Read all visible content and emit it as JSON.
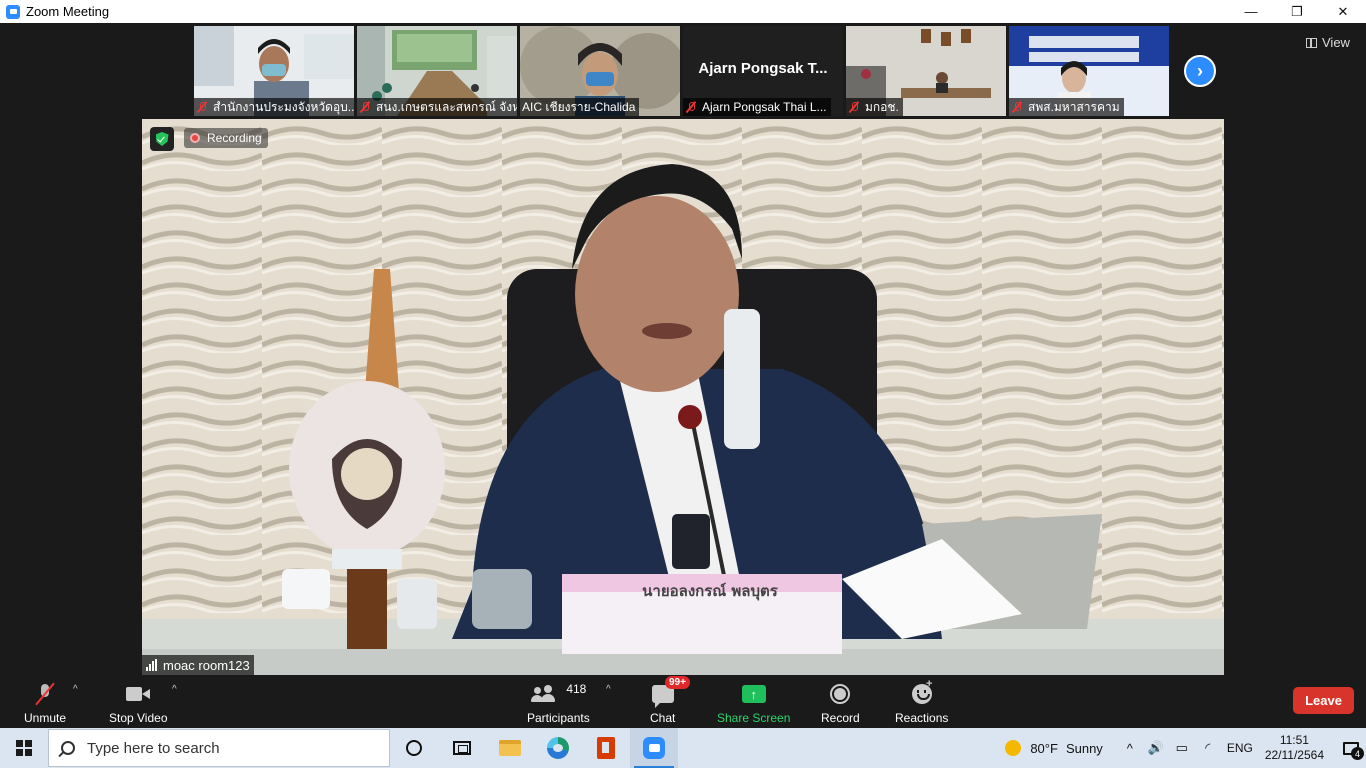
{
  "window": {
    "title": "Zoom Meeting",
    "minimize": "—",
    "restore": "❐",
    "close": "✕"
  },
  "gallery": {
    "participants": [
      {
        "name": "สำนักงานประมงจังหวัดอุบ...",
        "muted": true,
        "type": "video"
      },
      {
        "name": "สนง.เกษตรและสหกรณ์ จังหวั...",
        "muted": true,
        "type": "video"
      },
      {
        "name": "AIC เชียงราย-Chalida",
        "muted": false,
        "type": "video"
      },
      {
        "name": "Ajarn Pongsak Thai L...",
        "display_name": "Ajarn Pongsak T...",
        "muted": true,
        "type": "name"
      },
      {
        "name": "มกอช.",
        "muted": true,
        "type": "video"
      },
      {
        "name": "สพส.มหาสารคาม",
        "muted": true,
        "type": "video"
      }
    ],
    "next_icon": "chevron-right",
    "view_label": "View"
  },
  "main_video": {
    "recording_label": "Recording",
    "speaker_name": "moac room123",
    "nameplate_text": "นายอลงกรณ์  พลบุตร",
    "colors": {
      "shield": "#25c45a",
      "recording_dot": "#e64545"
    }
  },
  "toolbar": {
    "unmute_label": "Unmute",
    "stop_video_label": "Stop Video",
    "participants_label": "Participants",
    "participants_count": "418",
    "chat_label": "Chat",
    "chat_badge": "99+",
    "share_label": "Share Screen",
    "share_arrow": "↑",
    "record_label": "Record",
    "reactions_label": "Reactions",
    "reactions_plus": "+",
    "leave_label": "Leave",
    "caret": "^",
    "colors": {
      "share": "#1fbf5b",
      "leave": "#d9342b",
      "badge": "#e02828"
    }
  },
  "taskbar": {
    "search_placeholder": "Type here to search",
    "weather_temp": "80°F",
    "weather_desc": "Sunny",
    "tray_chevron": "^",
    "volume_icon": "🔊",
    "lang": "ENG",
    "time": "11:51",
    "date": "22/11/2564",
    "notifications_count": "4"
  }
}
